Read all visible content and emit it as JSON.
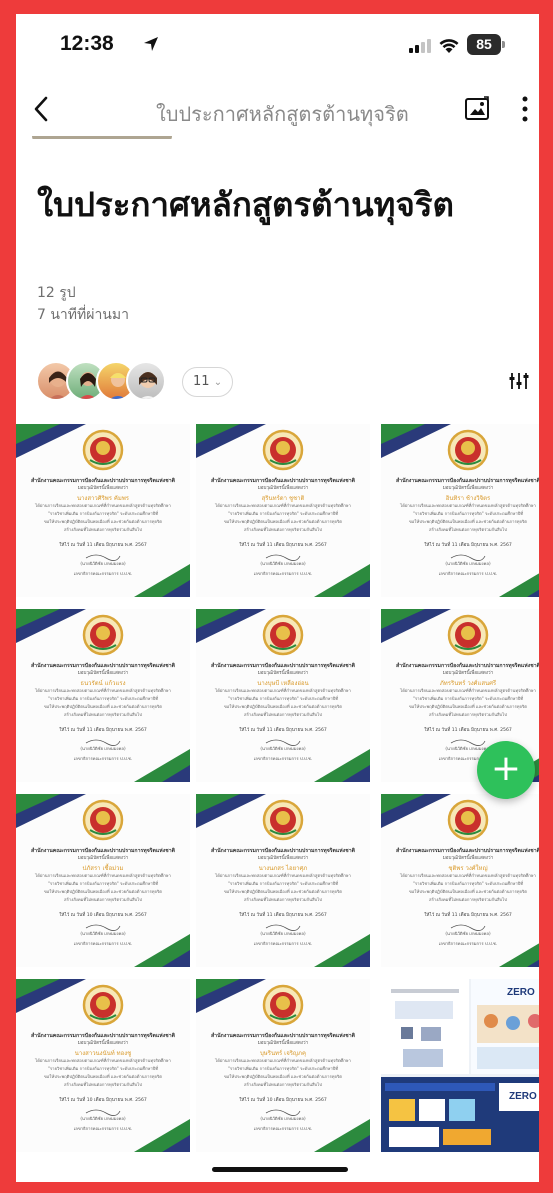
{
  "status_bar": {
    "time": "12:38",
    "battery": "85"
  },
  "nav": {
    "title": "ใบประกาศหลักสูตรต้านทุจริต"
  },
  "album": {
    "title": "ใบประกาศหลักสูตรต้านทุจริต",
    "photo_count": "12 รูป",
    "updated": "7 นาทีที่ผ่านมา"
  },
  "members": {
    "count_label": "11"
  },
  "certificate": {
    "header": "สำนักงานคณะกรรมการป้องกันและปราบปรามการทุจริตแห่งชาติ",
    "subtitle": "มอบวุฒิบัตรนี้เพื่อแสดงว่า",
    "body_lines": [
      "ได้ผ่านการเรียนและทดสอบตามเกณฑ์ที่กำหนดของหลักสูตรต้านทุจริตศึกษา",
      "\"รายวิชาเพิ่มเติม การป้องกันการทุจริต\" ระดับประถมศึกษาปีที่",
      "ขอให้ประพฤติปฏิบัติตนเป็นพลเมืองที่ และช่วยกันต่อต้านการทุจริต",
      "สร้างสังคมที่ไม่ทนต่อการทุจริตร่วมกันสืบไป"
    ],
    "signer": "(นายนิวัติชัย เกษมมงคล)",
    "org": "เลขาธิการคณะกรรมการ ป.ป.ช."
  },
  "photos": [
    {
      "name": "นางสาวศิริพร คัมพร",
      "date": "ให้ไว้ ณ วันที่ 11 เดือน มิถุนายน พ.ศ. 2567"
    },
    {
      "name": "สุรินทร์ดา ชูชาติ",
      "date": "ให้ไว้ ณ วันที่ 11 เดือน มิถุนายน พ.ศ. 2567"
    },
    {
      "name": "อินทิรา ช้างวิจิตร",
      "date": "ให้ไว้ ณ วันที่ 11 เดือน มิถุนายน พ.ศ. 2567"
    },
    {
      "name": "ธนวรัตน์ แก้วแรง",
      "date": "ให้ไว้ ณ วันที่ 11 เดือน มิถุนายน พ.ศ. 2567"
    },
    {
      "name": "นางบุษบี เหลืองอ่อน",
      "date": "ให้ไว้ ณ วันที่ 11 เดือน มิถุนายน พ.ศ. 2567"
    },
    {
      "name": "ภัทรรินทร์ วงศ์แสนศรี",
      "date": "ให้ไว้ ณ วันที่ 11 เดือน มิถุนายน พ.ศ. 2567"
    },
    {
      "name": "ปภัสรา เชื้อม่วม",
      "date": "ให้ไว้ ณ วันที่ 10 เดือน มิถุนายน พ.ศ. 2567"
    },
    {
      "name": "นางนภสร ไอยาศุภ",
      "date": "ให้ไว้ ณ วันที่ 11 เดือน มิถุนายน พ.ศ. 2567"
    },
    {
      "name": "ชุติพร วงศ์ใหญ่",
      "date": "ให้ไว้ ณ วันที่ 11 เดือน มิถุนายน พ.ศ. 2567"
    },
    {
      "name": "นางสาวนงนันท์ ทองชู",
      "date": "ให้ไว้ ณ วันที่ 10 เดือน มิถุนายน พ.ศ. 2567"
    },
    {
      "name": "บุษรินทร์ เจริญภคุ",
      "date": "ให้ไว้ ณ วันที่ 10 เดือน มิถุนายน พ.ศ. 2567"
    }
  ],
  "collage": {
    "badges": [
      "ZERO",
      "ZERO"
    ]
  },
  "fab": {
    "label": "+"
  },
  "colors": {
    "frame": "#ee3b3b",
    "fab": "#2ec15b",
    "cert_green": "#2c8a3e",
    "cert_navy": "#2a3a7a",
    "cert_gold": "#d9a63a",
    "cert_name": "#d99a2b"
  }
}
